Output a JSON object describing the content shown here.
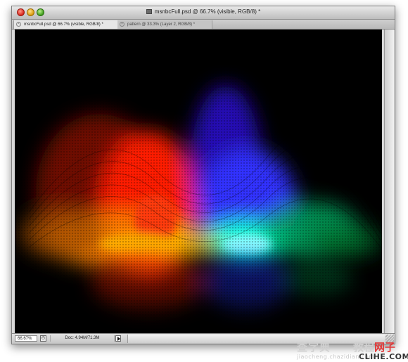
{
  "window": {
    "title": "msnbcFull.psd @ 66.7% (visible, RGB/8) *"
  },
  "tabs": [
    {
      "label": "msnbcFull.psd @ 66.7% (visible, RGB/8) *",
      "active": true
    },
    {
      "label": "pattern @ 33.3% (Layer 2, RGB/8) *",
      "active": false
    }
  ],
  "status": {
    "zoom": "66.67%",
    "doc_info": "Doc: 4.94M/71.3M"
  },
  "canvas": {
    "description_colors": [
      "#ff2a00",
      "#ff9a00",
      "#3a1aff",
      "#00ffd5",
      "#00c060"
    ]
  },
  "watermark": {
    "main": "查字典",
    "accent_prefix": "教程",
    "accent_highlight": "网子",
    "sub": "jiaocheng.chazidian.com",
    "site": "CLIHE.COM"
  }
}
